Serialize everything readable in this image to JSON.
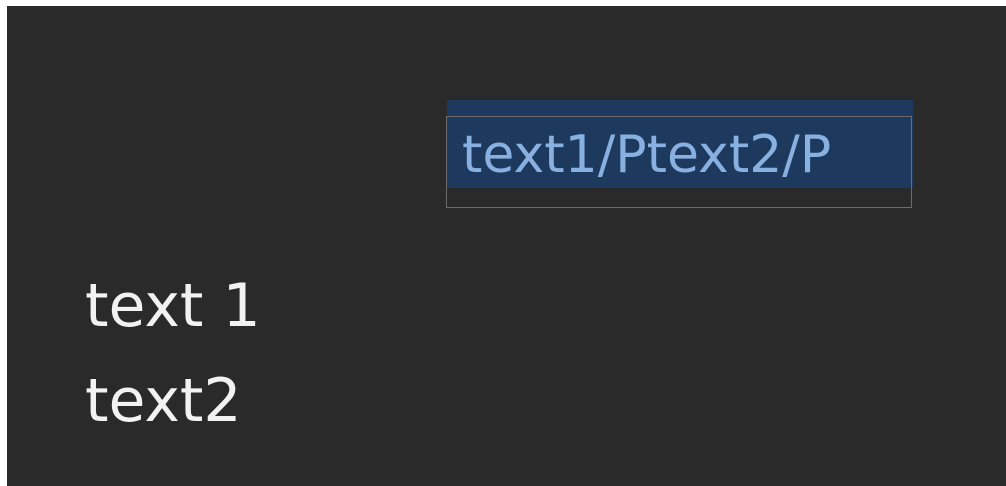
{
  "editor": {
    "input_value": "text1/Ptext2/P"
  },
  "preview": {
    "lines": [
      "text 1",
      "text2"
    ]
  },
  "colors": {
    "background": "#2a2a2a",
    "selection": "#1d3a5e",
    "input_text": "#88b0e0",
    "input_border": "#6b6b6b",
    "preview_text": "#f2f2f2"
  }
}
